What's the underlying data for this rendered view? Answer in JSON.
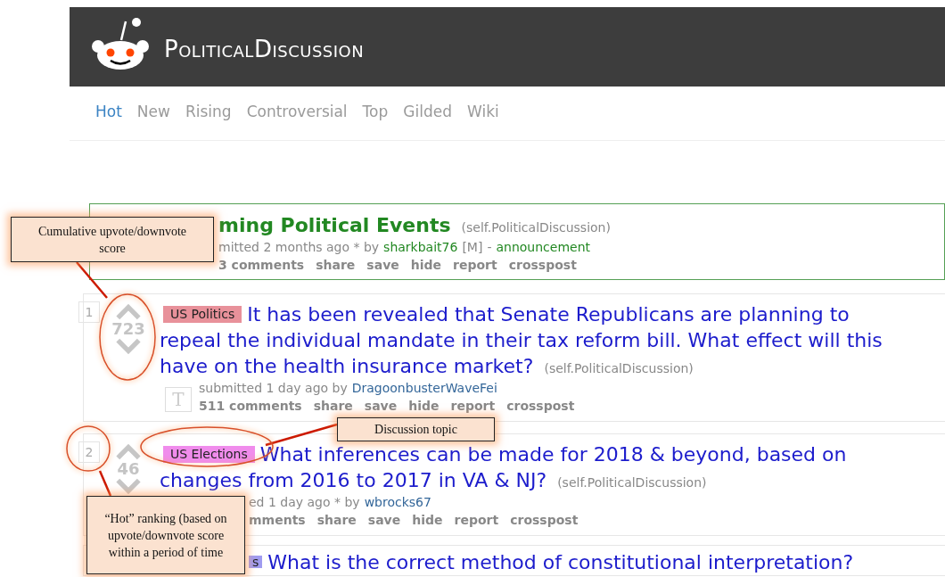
{
  "header": {
    "subreddit": "PoliticalDiscussion"
  },
  "tabs": [
    {
      "label": "Hot",
      "selected": true
    },
    {
      "label": "New",
      "selected": false
    },
    {
      "label": "Rising",
      "selected": false
    },
    {
      "label": "Controversial",
      "selected": false
    },
    {
      "label": "Top",
      "selected": false
    },
    {
      "label": "Gilded",
      "selected": false
    },
    {
      "label": "Wiki",
      "selected": false
    }
  ],
  "posts": [
    {
      "kind": "sticky",
      "vote_arrows": false,
      "title": "ming Political Events",
      "domain": "(self.PoliticalDiscussion)",
      "submitted": "mitted 2 months ago * by",
      "author": "sharkbait76",
      "moderator": "[M]",
      "separator": "-",
      "tag": "announcement",
      "actions": [
        "3 comments",
        "share",
        "save",
        "hide",
        "report",
        "crosspost"
      ]
    },
    {
      "kind": "normal",
      "rank": "1",
      "vote_arrows": true,
      "score": "723",
      "flair": "US Politics",
      "color": "#e8919a",
      "title": "It has been revealed that Senate Republicans are planning to repeal the individual mandate in their tax reform bill. What effect will this have on the health insurance market?",
      "domain": "(self.PoliticalDiscussion)",
      "thumbnail": "T",
      "submitted": "submitted 1 day ago by",
      "author": "DragoonbusterWaveFei",
      "actions": [
        "511 comments",
        "share",
        "save",
        "hide",
        "report",
        "crosspost"
      ]
    },
    {
      "kind": "normal",
      "rank": "2",
      "vote_arrows": true,
      "score": "46",
      "flair": "US Elections",
      "color": "#f08cec",
      "title": "What inferences can be made for 2018 & beyond, based on changes from 2016 to 2017 in VA & NJ?",
      "domain": "(self.PoliticalDiscussion)",
      "submitted": "ed 1 day ago * by",
      "author": "wbrocks67",
      "actions": [
        "mments",
        "share",
        "save",
        "hide",
        "report",
        "crosspost"
      ]
    },
    {
      "kind": "normal",
      "vote_arrows": false,
      "flair": "s",
      "color": "#a09cf0",
      "title": "What is the correct method of constitutional interpretation?"
    }
  ],
  "annotations": [
    {
      "text": "Cumulative  upvote/downvote score"
    },
    {
      "text": "Discussion topic"
    },
    {
      "text": "“Hot” ranking  (based on upvote/downvote score within  a period of time"
    }
  ]
}
